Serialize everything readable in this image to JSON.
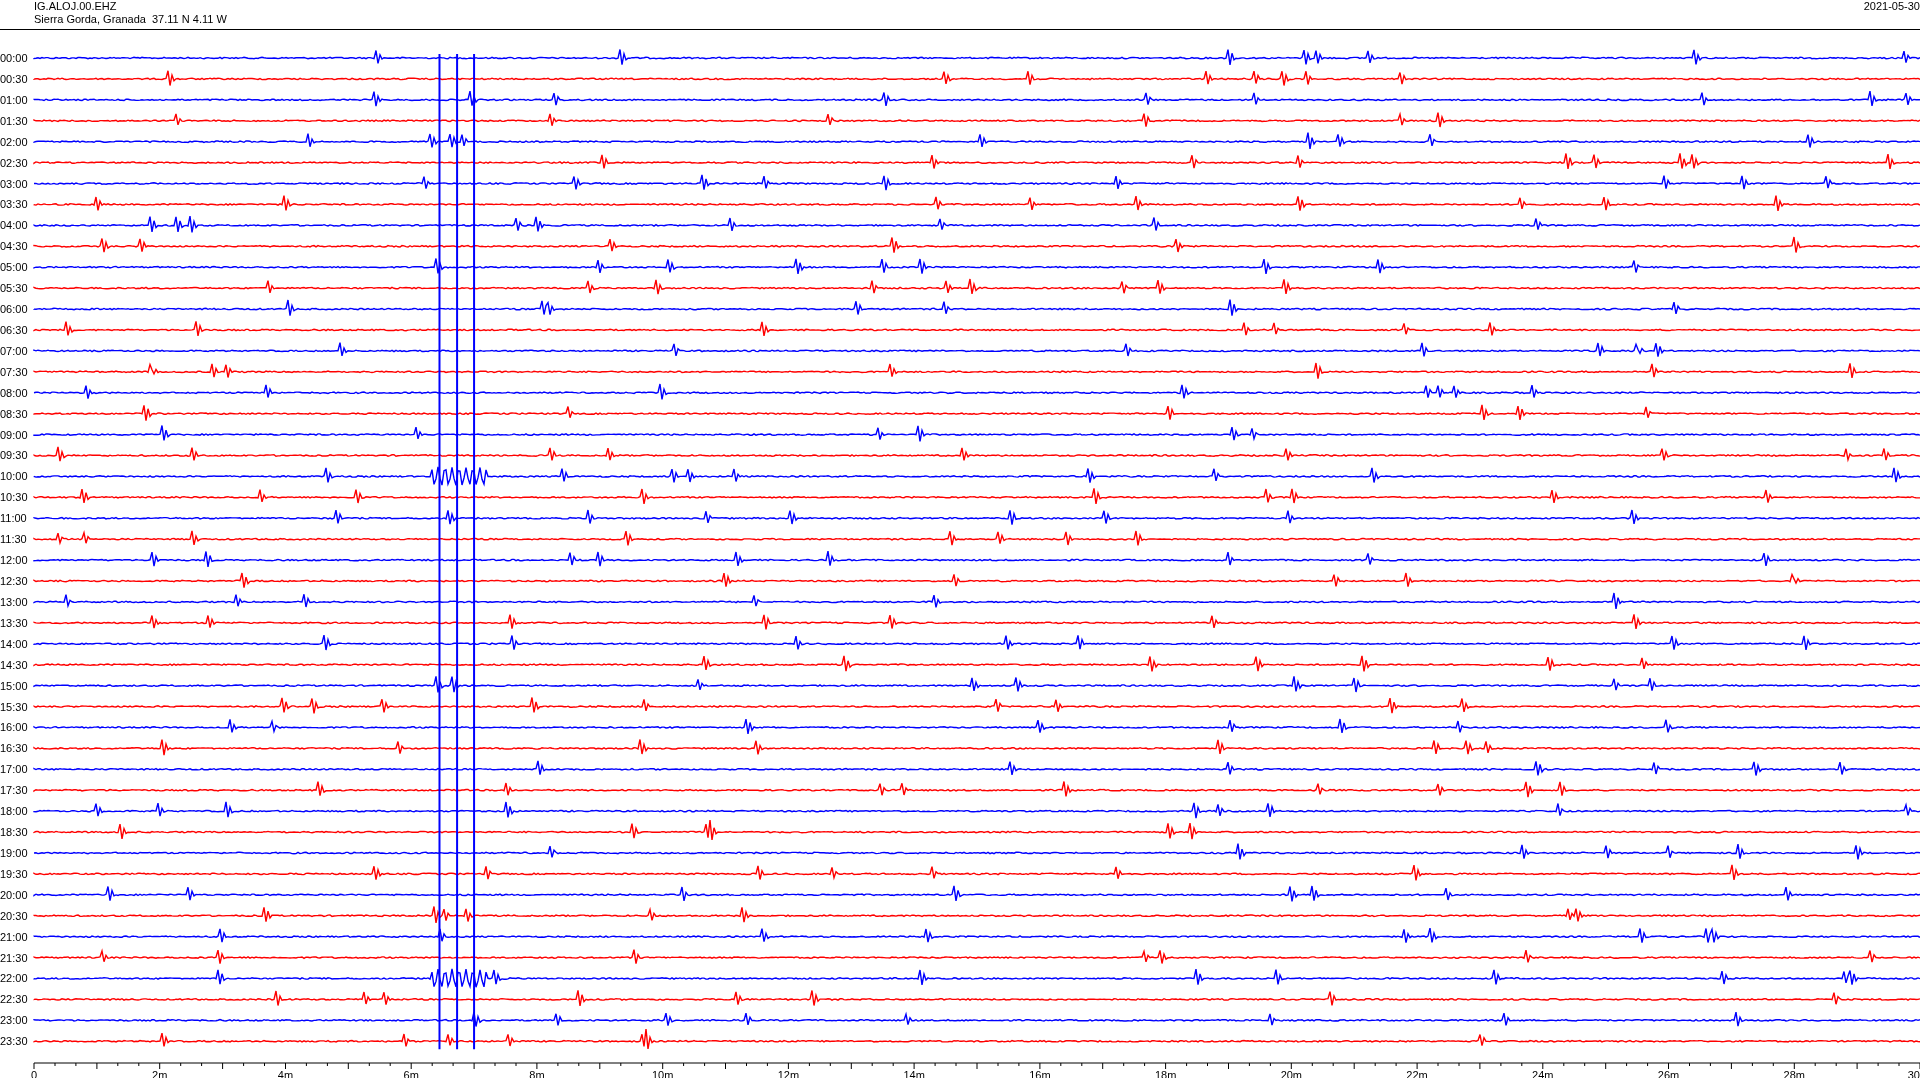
{
  "header": {
    "station": "IG.ALOJ.00.EHZ",
    "location": "Sierra Gorda, Granada  37.11 N 4.11 W",
    "date": "2021-05-30"
  },
  "rows": [
    {
      "label": "00:00",
      "color": "#0000ff"
    },
    {
      "label": "00:30",
      "color": "#ff0000"
    },
    {
      "label": "01:00",
      "color": "#0000ff"
    },
    {
      "label": "01:30",
      "color": "#ff0000"
    },
    {
      "label": "02:00",
      "color": "#0000ff"
    },
    {
      "label": "02:30",
      "color": "#ff0000"
    },
    {
      "label": "03:00",
      "color": "#0000ff"
    },
    {
      "label": "03:30",
      "color": "#ff0000"
    },
    {
      "label": "04:00",
      "color": "#0000ff"
    },
    {
      "label": "04:30",
      "color": "#ff0000"
    },
    {
      "label": "05:00",
      "color": "#0000ff"
    },
    {
      "label": "05:30",
      "color": "#ff0000"
    },
    {
      "label": "06:00",
      "color": "#0000ff"
    },
    {
      "label": "06:30",
      "color": "#ff0000"
    },
    {
      "label": "07:00",
      "color": "#0000ff"
    },
    {
      "label": "07:30",
      "color": "#ff0000"
    },
    {
      "label": "08:00",
      "color": "#0000ff"
    },
    {
      "label": "08:30",
      "color": "#ff0000"
    },
    {
      "label": "09:00",
      "color": "#0000ff"
    },
    {
      "label": "09:30",
      "color": "#ff0000"
    },
    {
      "label": "10:00",
      "color": "#0000ff"
    },
    {
      "label": "10:30",
      "color": "#ff0000"
    },
    {
      "label": "11:00",
      "color": "#0000ff"
    },
    {
      "label": "11:30",
      "color": "#ff0000"
    },
    {
      "label": "12:00",
      "color": "#0000ff"
    },
    {
      "label": "12:30",
      "color": "#ff0000"
    },
    {
      "label": "13:00",
      "color": "#0000ff"
    },
    {
      "label": "13:30",
      "color": "#ff0000"
    },
    {
      "label": "14:00",
      "color": "#0000ff"
    },
    {
      "label": "14:30",
      "color": "#ff0000"
    },
    {
      "label": "15:00",
      "color": "#0000ff"
    },
    {
      "label": "15:30",
      "color": "#ff0000"
    },
    {
      "label": "16:00",
      "color": "#0000ff"
    },
    {
      "label": "16:30",
      "color": "#ff0000"
    },
    {
      "label": "17:00",
      "color": "#0000ff"
    },
    {
      "label": "17:30",
      "color": "#ff0000"
    },
    {
      "label": "18:00",
      "color": "#0000ff"
    },
    {
      "label": "18:30",
      "color": "#ff0000"
    },
    {
      "label": "19:00",
      "color": "#0000ff"
    },
    {
      "label": "19:30",
      "color": "#ff0000"
    },
    {
      "label": "20:00",
      "color": "#0000ff"
    },
    {
      "label": "20:30",
      "color": "#ff0000"
    },
    {
      "label": "21:00",
      "color": "#0000ff"
    },
    {
      "label": "21:30",
      "color": "#ff0000"
    },
    {
      "label": "22:00",
      "color": "#0000ff"
    },
    {
      "label": "22:30",
      "color": "#ff0000"
    },
    {
      "label": "23:00",
      "color": "#0000ff"
    },
    {
      "label": "23:30",
      "color": "#ff0000"
    }
  ],
  "x_axis": {
    "labels": [
      "0",
      "2m",
      "4m",
      "6m",
      "8m",
      "10m",
      "12m",
      "14m",
      "16m",
      "18m",
      "20m",
      "22m",
      "24m",
      "26m",
      "28m",
      "30"
    ]
  }
}
